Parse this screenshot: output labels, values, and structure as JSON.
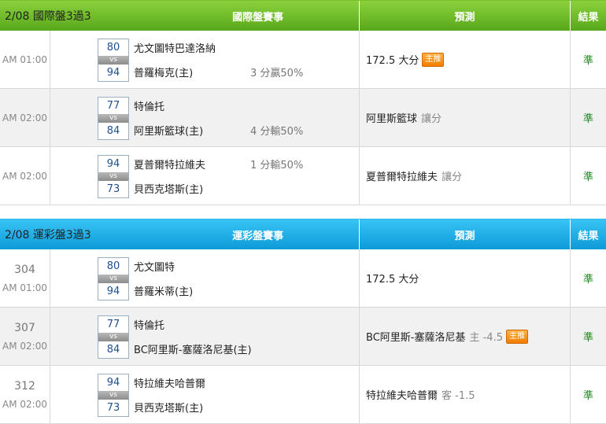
{
  "sections": [
    {
      "date_title": "2/08 國際盤3過3",
      "col_event": "國際盤賽事",
      "col_predict": "預測",
      "col_result": "結果",
      "rows": [
        {
          "time": "AM 01:00",
          "score_top": "80",
          "vs": "vs",
          "score_bottom": "94",
          "team_top": "尤文圖特巴達洛納",
          "team_bottom": "普羅梅克(主)",
          "spread": "3 分贏50%",
          "prediction": "172.5 大分",
          "prediction_extra": "",
          "badge": "主推",
          "result": "準"
        },
        {
          "time": "AM 02:00",
          "score_top": "77",
          "vs": "vs",
          "score_bottom": "84",
          "team_top": "特倫托",
          "team_bottom": "阿里斯籃球(主)",
          "spread": "4 分輸50%",
          "prediction": "阿里斯籃球",
          "prediction_extra": "讓分",
          "badge": "",
          "result": "準"
        },
        {
          "time": "AM 02:00",
          "score_top": "94",
          "vs": "vs",
          "score_bottom": "73",
          "team_top": "夏普爾特拉維夫",
          "team_bottom": "貝西克塔斯(主)",
          "spread": "1 分輸50%",
          "prediction": "夏普爾特拉維夫",
          "prediction_extra": "讓分",
          "badge": "",
          "result": "準"
        }
      ]
    },
    {
      "date_title": "2/08 運彩盤3過3",
      "col_event": "運彩盤賽事",
      "col_predict": "預測",
      "col_result": "結果",
      "rows": [
        {
          "num": "304",
          "time": "AM 01:00",
          "score_top": "80",
          "vs": "vs",
          "score_bottom": "94",
          "team_top": "尤文圖特",
          "team_bottom": "普羅米蒂(主)",
          "prediction": "172.5 大分",
          "prediction_extra": "",
          "badge": "",
          "result": "準"
        },
        {
          "num": "307",
          "time": "AM 02:00",
          "score_top": "77",
          "vs": "vs",
          "score_bottom": "84",
          "team_top": "特倫托",
          "team_bottom": "BC阿里斯-塞薩洛尼基(主)",
          "prediction": "BC阿里斯-塞薩洛尼基",
          "prediction_extra": "主 -4.5",
          "badge": "主推",
          "result": "準"
        },
        {
          "num": "312",
          "time": "AM 02:00",
          "score_top": "94",
          "vs": "vs",
          "score_bottom": "73",
          "team_top": "特拉維夫哈普爾",
          "team_bottom": "貝西克塔斯(主)",
          "prediction": "特拉維夫哈普爾",
          "prediction_extra": "客 -1.5",
          "badge": "",
          "result": "準"
        }
      ]
    }
  ]
}
